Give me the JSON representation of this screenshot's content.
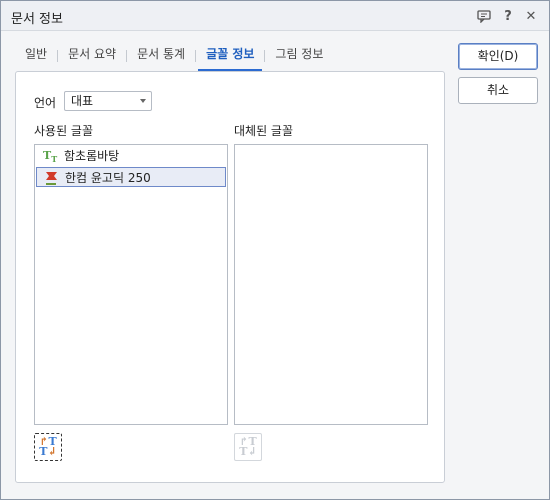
{
  "window": {
    "title": "문서 정보"
  },
  "titlebar": {
    "help": "?",
    "close": "✕"
  },
  "tabs": [
    {
      "label": "일반"
    },
    {
      "label": "문서 요약"
    },
    {
      "label": "문서 통계"
    },
    {
      "label": "글꼴 정보"
    },
    {
      "label": "그림 정보"
    }
  ],
  "active_tab": "글꼴 정보",
  "language": {
    "label": "언어",
    "value": "대표"
  },
  "used_fonts": {
    "title": "사용된 글꼴",
    "items": [
      {
        "name": "함초롬바탕",
        "icon": "truetype-font-icon"
      },
      {
        "name": "한컴 윤고딕 250",
        "icon": "hancom-font-icon",
        "selected": true
      }
    ]
  },
  "replaced_fonts": {
    "title": "대체된 글꼴",
    "items": []
  },
  "buttons": {
    "ok": "확인(D)",
    "cancel": "취소"
  },
  "colors": {
    "accent": "#2c6bd1",
    "active_tab_text": "#1f5fbf"
  }
}
